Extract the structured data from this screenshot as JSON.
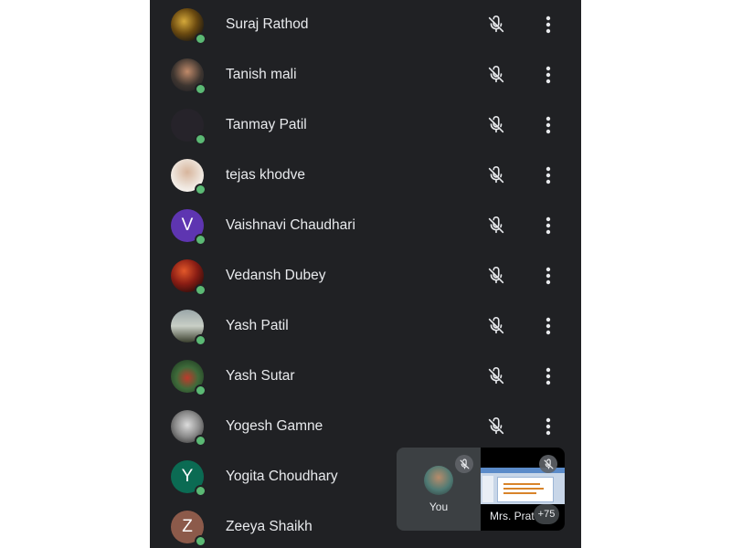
{
  "participants": [
    {
      "name": "Suraj Rathod",
      "avatar_letter": "",
      "avatar_icon": "photo-avatar",
      "status": "online",
      "mic": "muted"
    },
    {
      "name": "Tanish mali",
      "avatar_letter": "",
      "avatar_icon": "photo-avatar",
      "status": "online",
      "mic": "muted"
    },
    {
      "name": "Tanmay Patil",
      "avatar_letter": "",
      "avatar_icon": "photo-avatar",
      "status": "online",
      "mic": "muted"
    },
    {
      "name": "tejas khodve",
      "avatar_letter": "",
      "avatar_icon": "photo-avatar",
      "status": "online",
      "mic": "muted"
    },
    {
      "name": "Vaishnavi Chaudhari",
      "avatar_letter": "V",
      "avatar_icon": "letter-avatar",
      "status": "online",
      "mic": "muted"
    },
    {
      "name": "Vedansh Dubey",
      "avatar_letter": "",
      "avatar_icon": "photo-avatar",
      "status": "online",
      "mic": "muted"
    },
    {
      "name": "Yash Patil",
      "avatar_letter": "",
      "avatar_icon": "photo-avatar",
      "status": "online",
      "mic": "muted"
    },
    {
      "name": "Yash Sutar",
      "avatar_letter": "",
      "avatar_icon": "photo-avatar",
      "status": "online",
      "mic": "muted"
    },
    {
      "name": "Yogesh Gamne",
      "avatar_letter": "",
      "avatar_icon": "photo-avatar",
      "status": "online",
      "mic": "muted"
    },
    {
      "name": "Yogita Choudhary",
      "avatar_letter": "Y",
      "avatar_icon": "letter-avatar",
      "status": "online",
      "mic": "muted"
    },
    {
      "name": "Zeeya Shaikh",
      "avatar_letter": "Z",
      "avatar_icon": "letter-avatar",
      "status": "online",
      "mic": "muted"
    }
  ],
  "self_tile": {
    "label": "You",
    "mic": "muted"
  },
  "share_tile": {
    "label": "Mrs. Prat",
    "mic": "muted",
    "more_count": "+75"
  },
  "colors": {
    "panel_bg": "#202124",
    "text": "#e8eaed",
    "icon": "#e8eaed",
    "online_dot": "#5bb974",
    "tile_bg": "#3c4043",
    "avatar_V": "#5e35b1",
    "avatar_Y": "#0b6b53",
    "avatar_Z": "#8c5a4a"
  }
}
